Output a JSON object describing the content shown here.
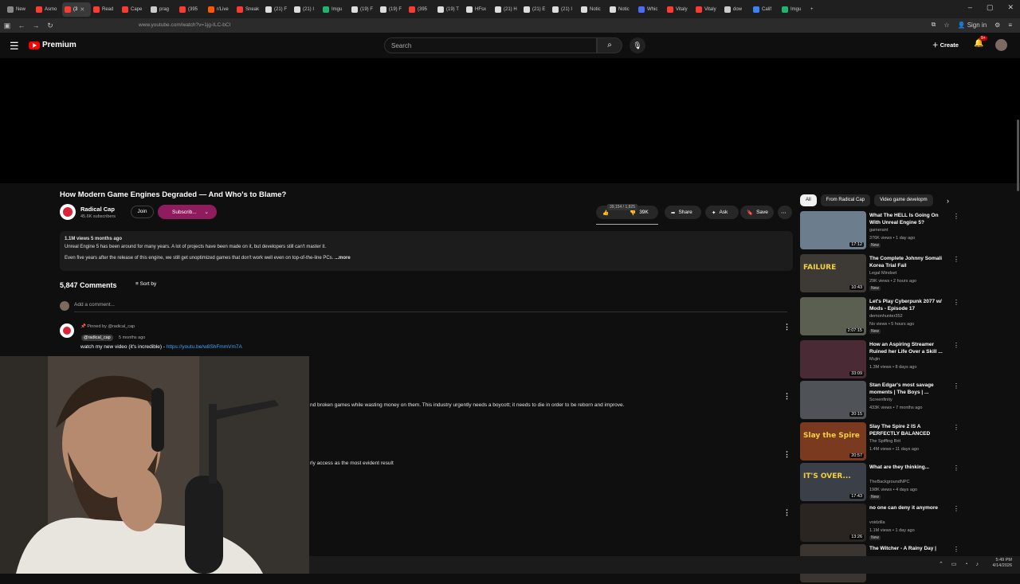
{
  "browser": {
    "tabs": [
      "New",
      "Asmo",
      "(3",
      "Read",
      "Cape",
      "prag",
      "(395",
      "r/Live",
      "Sneak",
      "(21) F",
      "(21) I",
      "Imgu",
      "(19) F",
      "(19) F",
      "(395",
      "(19) T",
      "HFsx",
      "(21) H",
      "(21) E",
      "(21) I",
      "Notic",
      "Notic",
      "Whic",
      "Vitaly",
      "Vitaly",
      "dow",
      "Calif",
      "Imgu"
    ],
    "tab_colors": [
      "#888888",
      "#ff3b30",
      "#ff3b30",
      "#ff3b30",
      "#ff3b30",
      "#cccccc",
      "#ff3b30",
      "#ff5700",
      "#ff3b30",
      "#dddddd",
      "#dddddd",
      "#1bb76e",
      "#dddddd",
      "#dddddd",
      "#ff3b30",
      "#dddddd",
      "#dddddd",
      "#dddddd",
      "#dddddd",
      "#dddddd",
      "#dddddd",
      "#dddddd",
      "#4a6cf7",
      "#ff3b30",
      "#ff3b30",
      "#cccccc",
      "#3b82f6",
      "#1bb76e"
    ],
    "url": "www.youtube.com/watch?v=1jg-ILC-bCI",
    "sign_in": "Sign in"
  },
  "header": {
    "logo": "Premium",
    "search_placeholder": "Search",
    "create": "Create",
    "notif_count": "9+"
  },
  "video": {
    "title": "How Modern Game Engines Degraded — And Who's to Blame?",
    "channel": "Radical Cap",
    "subscribers": "45.6K subscribers",
    "join": "Join",
    "subscribe": "Subscrib...",
    "like_tooltip": "39,154 / 1,825",
    "likes": "39K",
    "share": "Share",
    "ask": "Ask",
    "save": "Save",
    "description": {
      "meta": "1.1M views  5 months ago",
      "line1": "Unreal Engine 5 has been around for many years. A lot of projects have been made on it, but developers still can't master it.",
      "line2": "Even five years after the release of this engine, we still get unoptimized games that don't work well even on top-of-the-line PCs.",
      "more": "...more"
    }
  },
  "comments": {
    "count": "5,847 Comments",
    "sort": "Sort by",
    "add_placeholder": "Add a comment...",
    "pinned_label": "Pinned by @radical_cap",
    "pinned_handle": "@radical_cap",
    "pinned_time": "5 months ago",
    "pinned_text": "watch my new video (it's incredible) - ",
    "pinned_link": "https://youtu.be/w8ShFmmVm7A",
    "partial_1": "nd broken games while wasting money on them. This industry urgently needs a boycott; it needs to die in order to be reborn and improve.",
    "partial_2": "rly access as the most evident result"
  },
  "filters": [
    "All",
    "From Radical Cap",
    "Video game developm"
  ],
  "recommendations": [
    {
      "title": "What The HELL Is Going On With Unreal Engine 5?",
      "channel": "gamerant",
      "meta": "376K views • 1 day ago",
      "badge": "New",
      "duration": "17:12",
      "color": "#6c7d8e"
    },
    {
      "title": "The Complete Johnny Somali Korea Trial Fail",
      "channel": "Legal Mindset",
      "meta": "29K views • 2 hours ago",
      "badge": "New",
      "duration": "10:43",
      "color": "#3d3a35",
      "thumb_text": "FAILURE"
    },
    {
      "title": "Let's Play Cyberpunk 2077 w/ Mods - Episode 17",
      "channel": "demonhunter352",
      "meta": "No views • 5 hours ago",
      "badge": "New",
      "duration": "2:07:15",
      "color": "#5a5f52"
    },
    {
      "title": "How an Aspiring Streamer Ruined her Life Over a Skill ...",
      "channel": "Mujin",
      "meta": "1.3M views • 8 days ago",
      "badge": "",
      "duration": "33:09",
      "color": "#4a2a35"
    },
    {
      "title": "Stan Edgar's most savage moments | The Boys | ...",
      "channel": "Screenfinity",
      "meta": "433K views • 7 months ago",
      "badge": "",
      "duration": "20:15",
      "color": "#4f5357"
    },
    {
      "title": "Slay The Spire 2 IS A PERFECTLY BALANCED GAME...",
      "channel": "The Spiffing Brit",
      "meta": "1.4M views • 11 days ago",
      "badge": "",
      "duration": "20:57",
      "color": "#7a3a20",
      "thumb_text": "Slay the Spire"
    },
    {
      "title": "What are they thinking...",
      "channel": "TheBackgroundNPC",
      "meta": "198K views • 4 days ago",
      "badge": "New",
      "duration": "17:43",
      "color": "#3a3f48",
      "thumb_text": "IT'S OVER..."
    },
    {
      "title": "no one can deny it anymore",
      "channel": "voidzilla",
      "meta": "1.1M views • 1 day ago",
      "badge": "New",
      "duration": "13:26",
      "color": "#2a2520"
    },
    {
      "title": "The Witcher - A Rainy Day |",
      "channel": "",
      "meta": "",
      "badge": "",
      "duration": "",
      "color": "#3a3530"
    }
  ],
  "taskbar": {
    "time": "5:49 PM",
    "date": "4/14/2026"
  }
}
